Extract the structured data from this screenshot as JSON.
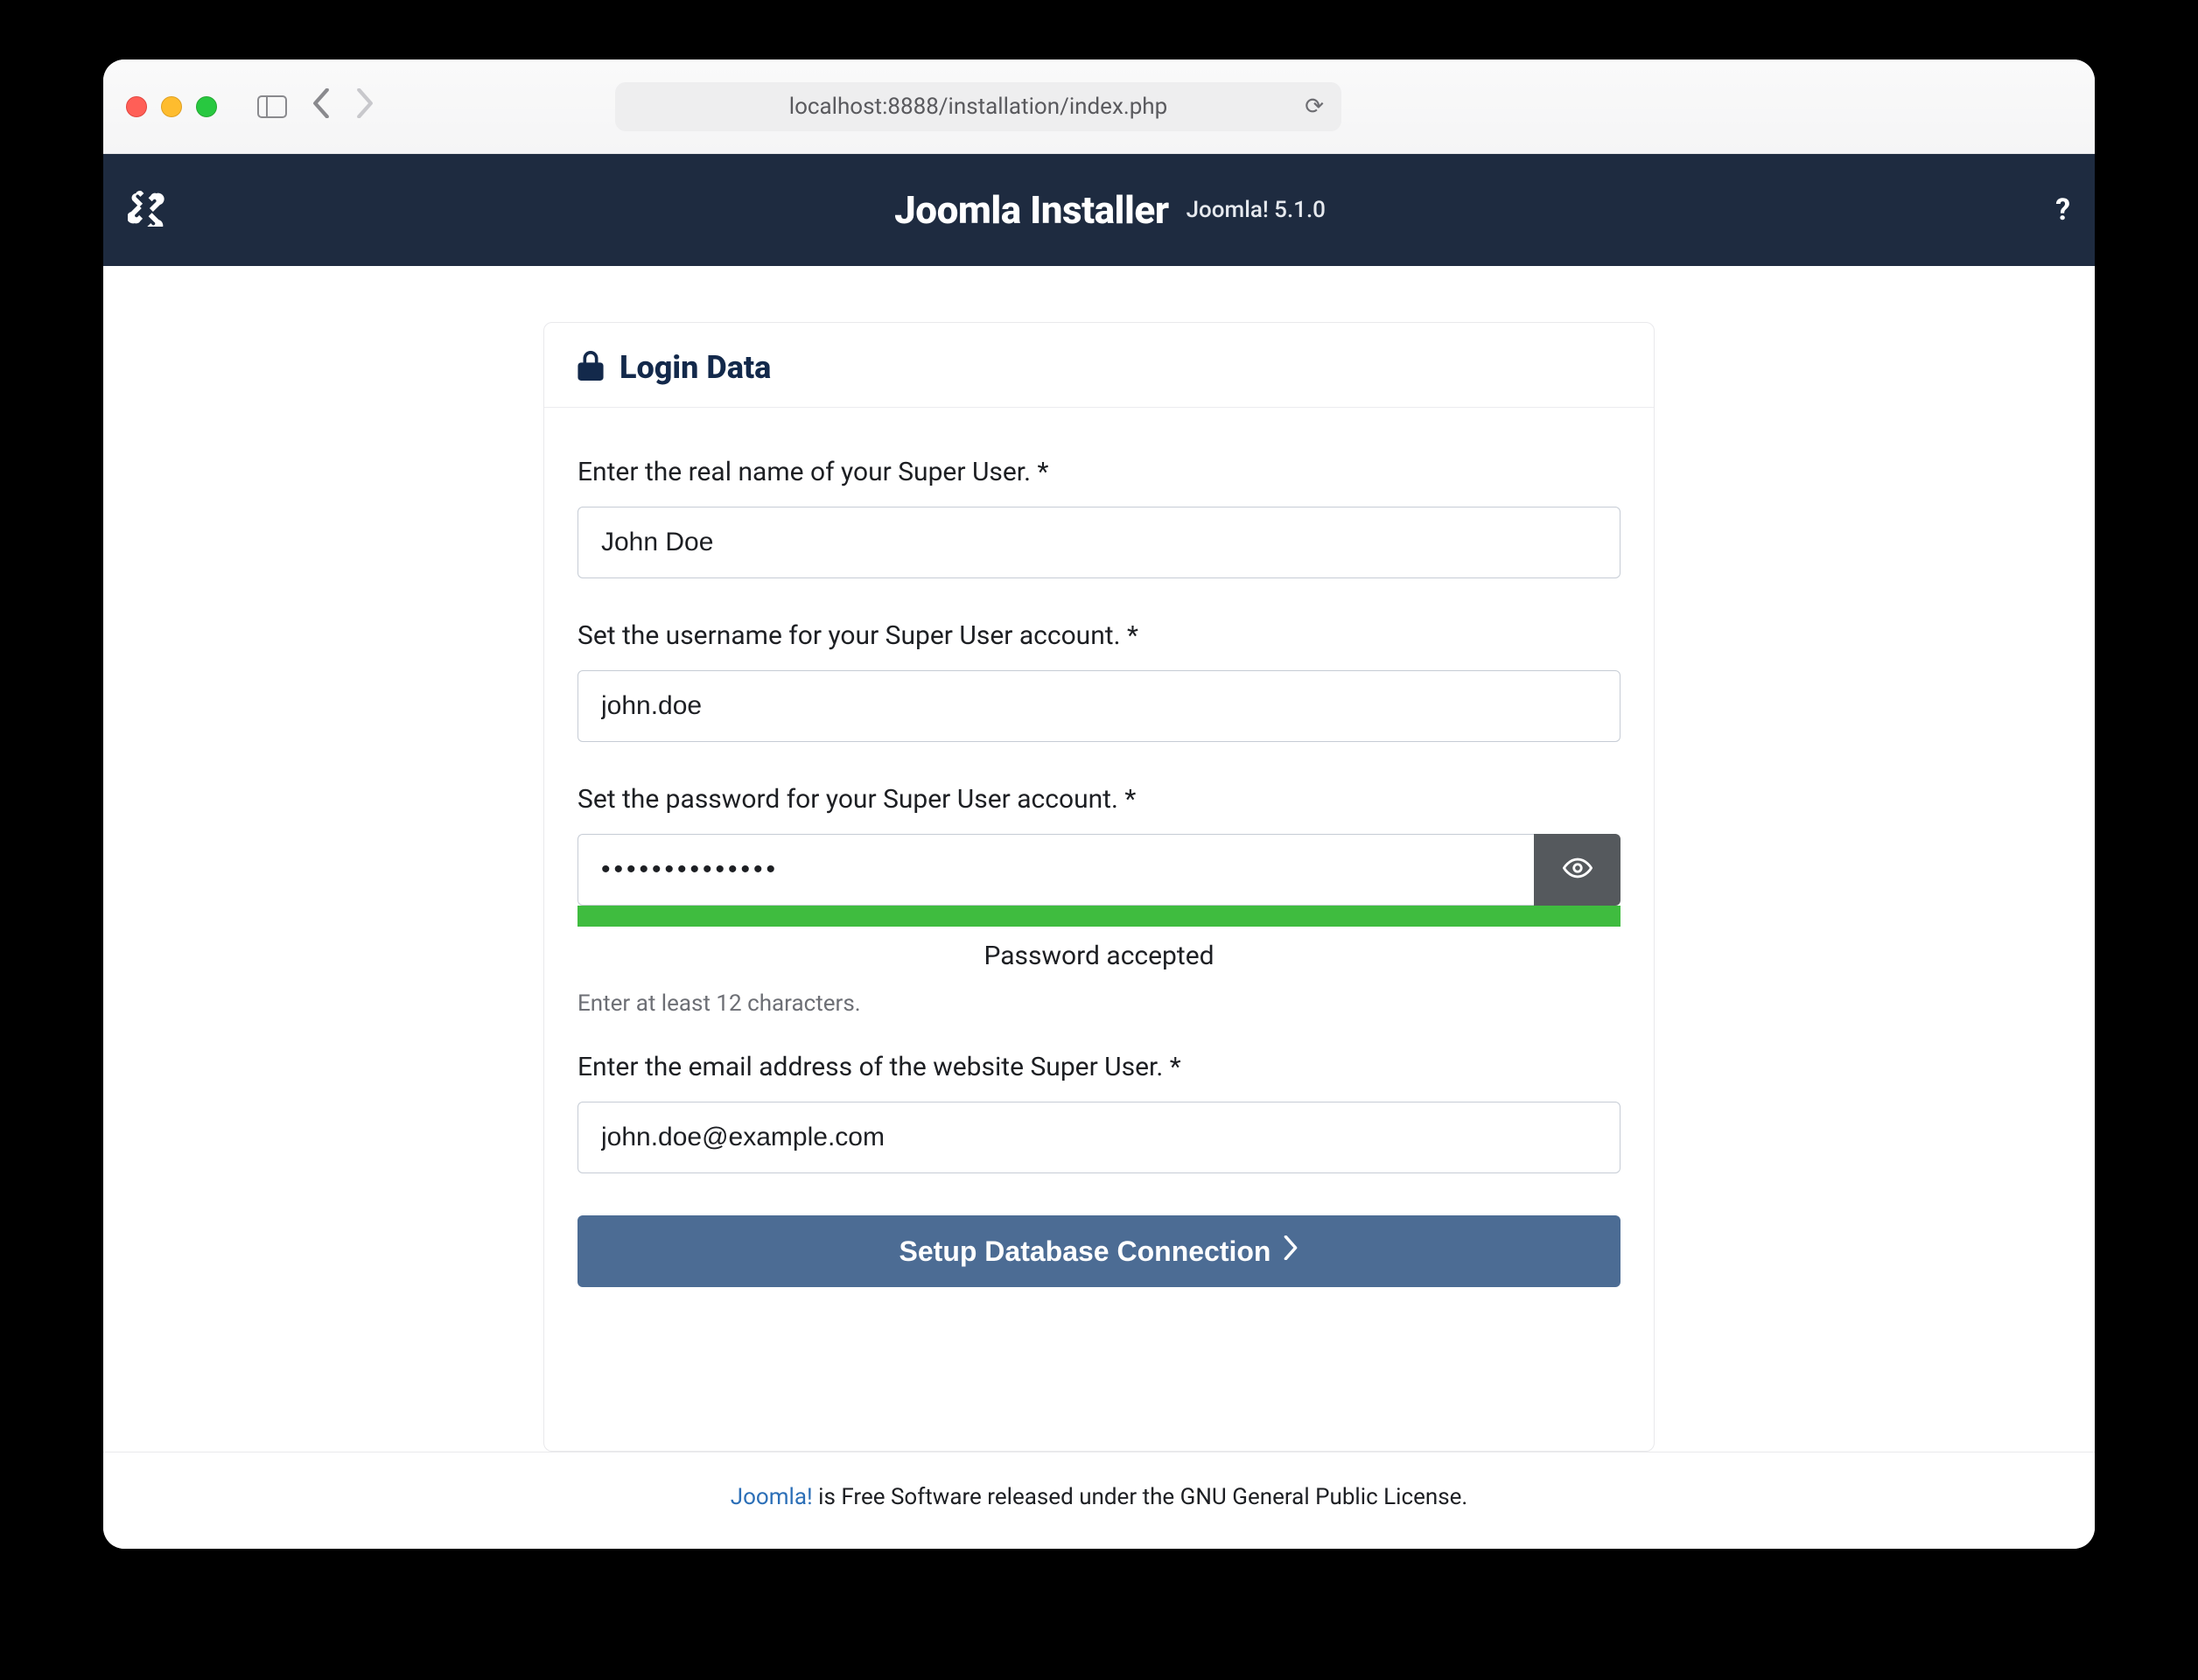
{
  "browser": {
    "url": "localhost:8888/installation/index.php"
  },
  "header": {
    "title": "Joomla Installer",
    "version": "Joomla! 5.1.0",
    "help_glyph": "?"
  },
  "card": {
    "title": "Login Data"
  },
  "fields": {
    "realname": {
      "label": "Enter the real name of your Super User. *",
      "value": "John Doe"
    },
    "username": {
      "label": "Set the username for your Super User account. *",
      "value": "john.doe"
    },
    "password": {
      "label": "Set the password for your Super User account. *",
      "value": "••••••••••••••",
      "status": "Password accepted",
      "hint": "Enter at least 12 characters."
    },
    "email": {
      "label": "Enter the email address of the website Super User. *",
      "value": "john.doe@example.com"
    }
  },
  "submit": {
    "label": "Setup Database Connection"
  },
  "footer": {
    "link_text": "Joomla!",
    "rest": " is Free Software released under the GNU General Public License."
  }
}
